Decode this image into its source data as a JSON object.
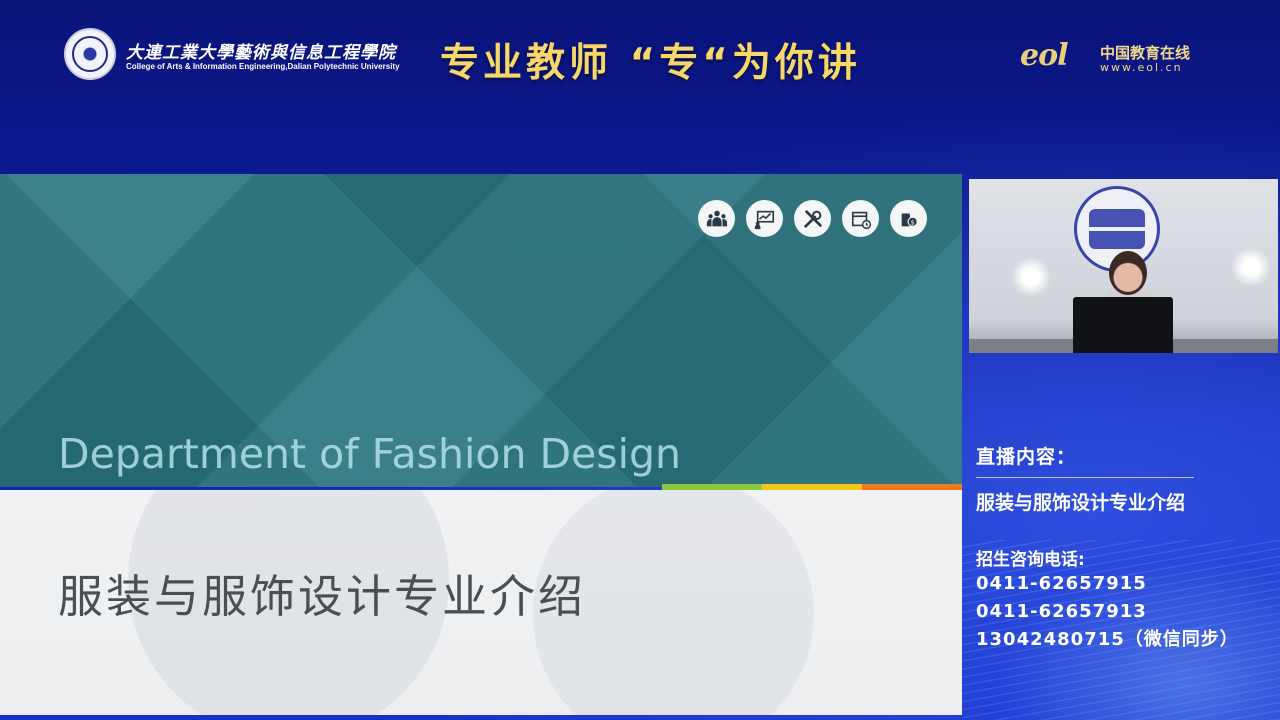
{
  "header": {
    "school_name_cn": "大連工業大學藝術與信息工程學院",
    "school_name_en": "College of Arts & Information Engineering,Dalian Polytechnic University",
    "title": "专业教师 “专“为你讲",
    "eol_mark": "eol",
    "eol_name": "中国教育在线",
    "eol_url": "www.eol.cn"
  },
  "slide": {
    "department_en": "Department of Fashion Design",
    "department_cn": "服装与服饰设计专业介绍",
    "icons": [
      "people-group-icon",
      "presentation-chart-icon",
      "tools-icon",
      "calendar-clock-icon",
      "money-icon"
    ],
    "stripe_colors": [
      "#8dc63f",
      "#f5c518",
      "#f07b1e"
    ],
    "teal_color": "#2b7580"
  },
  "info": {
    "live_label": "直播内容：",
    "live_topic": "服装与服饰设计专业介绍",
    "consult_label": "招生咨询电话:",
    "phones": [
      "0411-62657915",
      "0411-62657913",
      "13042480715（微信同步）"
    ]
  },
  "colors": {
    "background": "#0f20a8",
    "title_gold": "#f7d66a"
  }
}
